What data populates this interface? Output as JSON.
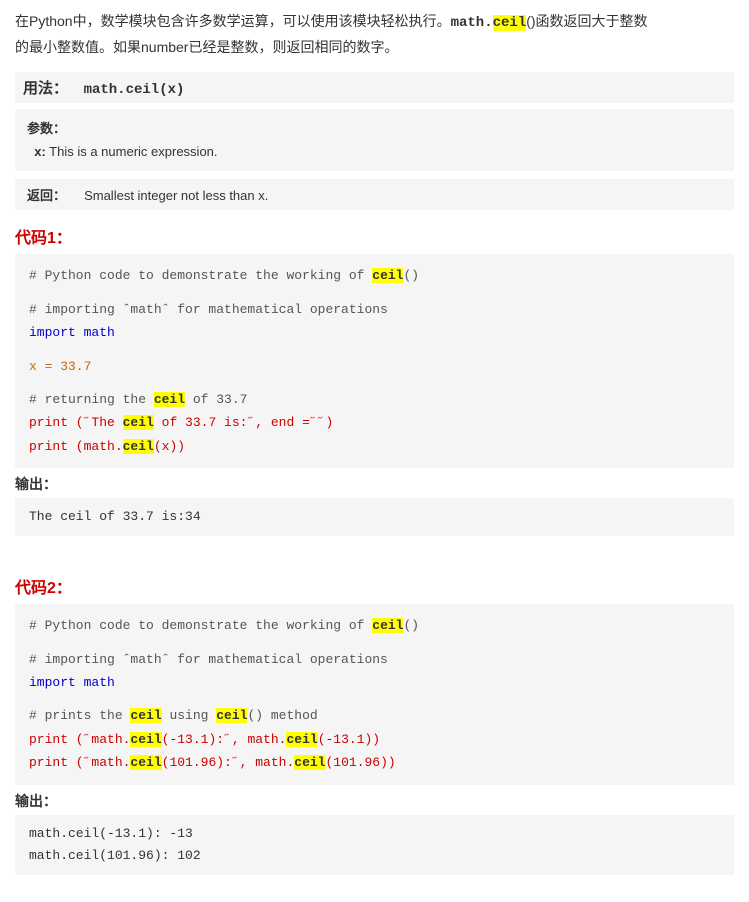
{
  "intro": {
    "text1": "在Python中，数学模块包含许多数学运算，可以使用该模块轻松执行。",
    "code_bold": "math.",
    "highlight1": "ceil",
    "text2": "()函数返回大于整数的最小整数值。如果number已经是整数，则返回相同的数字。"
  },
  "usage": {
    "label": "用法：",
    "value": "math.ceil(x)"
  },
  "params": {
    "label": "参数：",
    "param1": "x: This is a numeric expression."
  },
  "return": {
    "label": "返回：",
    "value": "Smallest integer not less than x."
  },
  "code1": {
    "heading": "代码1：",
    "lines": [
      {
        "type": "comment",
        "text": "# Python code to demonstrate the working of "
      },
      {
        "type": "blank"
      },
      {
        "type": "comment",
        "text": "# importing ˆmath˜ for mathematical operations"
      },
      {
        "type": "keyword",
        "text": "import math"
      },
      {
        "type": "blank"
      },
      {
        "type": "value",
        "text": "x = 33.7"
      },
      {
        "type": "blank"
      },
      {
        "type": "comment",
        "text": "# returning the "
      },
      {
        "type": "mixed_print1"
      },
      {
        "type": "mixed_print2"
      }
    ]
  },
  "output1": {
    "label": "输出：",
    "value": "The ceil of 33.7 is:34"
  },
  "code2": {
    "heading": "代码2：",
    "lines": []
  },
  "output2": {
    "label": "输出：",
    "line1": "math.ceil(-13.1): -13",
    "line2": "math.ceil(101.96): 102"
  }
}
